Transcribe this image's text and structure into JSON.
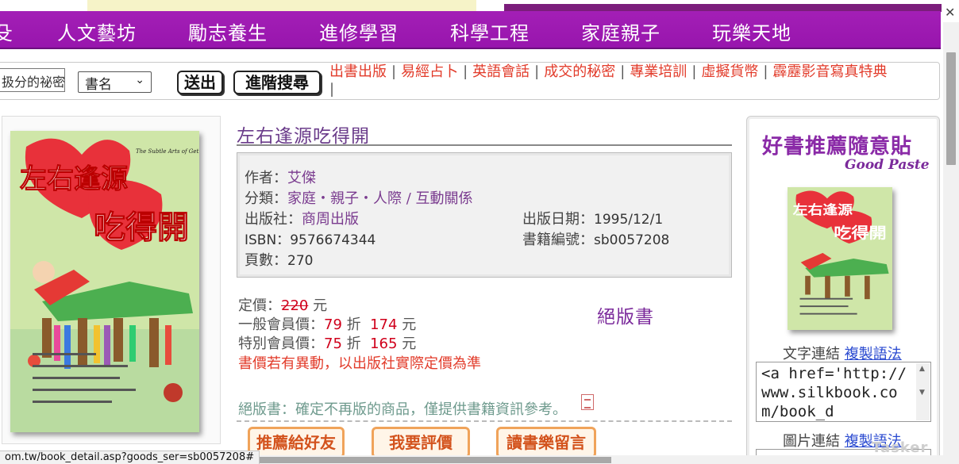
{
  "nav": {
    "items": [
      {
        "label": "人文藝坊"
      },
      {
        "label": "勵志養生"
      },
      {
        "label": "進修學習"
      },
      {
        "label": "科學工程"
      },
      {
        "label": "家庭親子"
      },
      {
        "label": "玩樂天地"
      }
    ],
    "partial_left": "殳"
  },
  "search": {
    "keyword_value": "扱分的祕密",
    "field_selected": "書名",
    "submit_label": "送出",
    "advanced_label": "進階搜尋"
  },
  "quick_links": [
    "出書出版",
    "易經占卜",
    "英語會話",
    "成交的秘密",
    "專業培訓",
    "虛擬貨幣",
    "霹靂影音寫真特典"
  ],
  "book": {
    "title": "左右逢源吃得開",
    "cover_title_line1": "左右逢源",
    "cover_title_line2": "吃得開",
    "cover_en": "The Subtle Arts of Getting Along",
    "author_label": "作者：",
    "author": "艾傑",
    "category_label": "分類：",
    "category": "家庭‧親子‧人際 / 互動關係",
    "publisher_label": "出版社：",
    "publisher": "商周出版",
    "pubdate_label": "出版日期：",
    "pubdate": "1995/12/1",
    "isbn_label": "ISBN：",
    "isbn": "9576674344",
    "bookno_label": "書籍編號：",
    "bookno": "sb0057208",
    "pages_label": "頁數：",
    "pages": "270"
  },
  "price": {
    "list_label": "定價：",
    "list_price": "220",
    "unit": "元",
    "member_label": "一般會員價：",
    "member_discount": "79",
    "member_price": "174",
    "special_label": "特別會員價：",
    "special_discount": "75",
    "special_price": "165",
    "discount_word": "折",
    "note": "書價若有異動，以出版社實際定價為準",
    "out_of_print": "絕版書",
    "out_of_print_note": "絕版書：確定不再版的商品，僅提供書籍資訊參考。"
  },
  "actions": {
    "recommend": "推薦給好友",
    "review": "我要評價",
    "message": "讀書樂留言"
  },
  "right_panel": {
    "title": "好書推薦隨意貼",
    "subtitle": "Good Paste",
    "text_link_label": "文字連結",
    "copy_label": "複製語法",
    "code_text": "<a href='http://www.silkbook.com/book_d",
    "image_link_label": "圖片連結",
    "copy_label2": "複製語法"
  },
  "status_bar": {
    "url": "om.tw/book_detail.asp?goods_ser=sb0057208#"
  },
  "watermark": "Tasker",
  "colors": {
    "nav_purple": "#a31fb6",
    "link_red": "#e23b2a",
    "price_red": "#d0001b",
    "title_purple": "#6a3b8a"
  }
}
